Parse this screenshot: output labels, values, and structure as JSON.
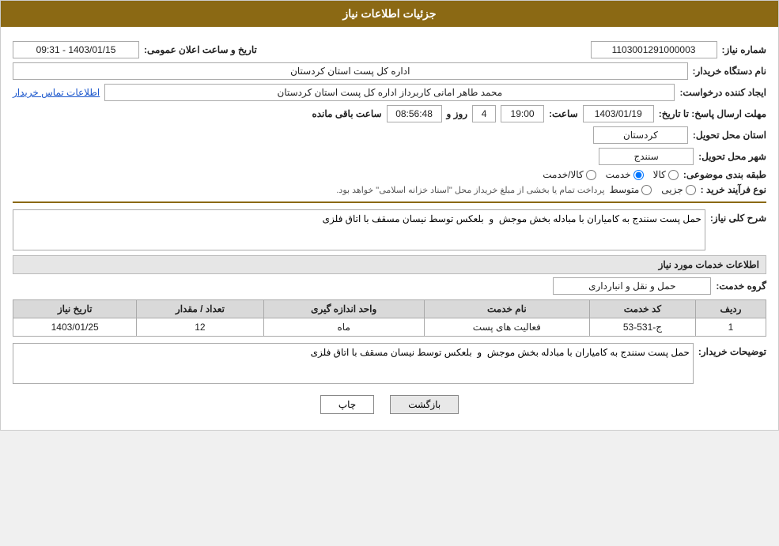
{
  "page": {
    "title": "جزئیات اطلاعات نیاز",
    "header_bg": "#8B6914"
  },
  "fields": {
    "shomara_niaz_label": "شماره نیاز:",
    "shomara_niaz_value": "1103001291000003",
    "nam_dastgah_label": "نام دستگاه خریدار:",
    "nam_dastgah_value": "اداره کل پست استان کردستان",
    "tarikh_label": "تاریخ و ساعت اعلان عمومی:",
    "tarikh_value": "1403/01/15 - 09:31",
    "ijad_konande_label": "ایجاد کننده درخواست:",
    "ijad_konande_value": "محمد طاهر امانی کاربرداز اداره کل پست استان کردستان",
    "ittila_tamas": "اطلاعات تماس خریدار",
    "mohlat_label": "مهلت ارسال پاسخ: تا تاریخ:",
    "mohlat_date": "1403/01/19",
    "mohlat_saat_label": "ساعت:",
    "mohlat_saat": "19:00",
    "mohlat_rooz_label": "روز و",
    "mohlat_rooz_value": "4",
    "mohlat_baqi_label": "ساعت باقی مانده",
    "mohlat_baqi_value": "08:56:48",
    "ostan_tahvil_label": "استان محل تحویل:",
    "ostan_tahvil_value": "کردستان",
    "shahr_tahvil_label": "شهر محل تحویل:",
    "shahr_tahvil_value": "سنندج",
    "tabaqe_label": "طبقه بندی موضوعی:",
    "tabaqe_options": [
      "کالا",
      "خدمت",
      "کالا/خدمت"
    ],
    "tabaqe_selected": "خدمت",
    "noe_farayand_label": "نوع فرآیند خرید :",
    "noe_farayand_options": [
      "جزیی",
      "متوسط"
    ],
    "noe_farayand_note": "پرداخت تمام یا بخشی از مبلغ خریداز محل \"اسناد خزانه اسلامی\" خواهد بود.",
    "sharh_label": "شرح کلی نیاز:",
    "sharh_value": "حمل پست سنندج به کامیاران با مبادله بخش موجش  و  بلعکس توسط نیسان مسقف با اتاق فلزی",
    "khadamat_section": "اطلاعات خدمات مورد نیاز",
    "goroh_label": "گروه خدمت:",
    "goroh_value": "حمل و نقل و انبارداری",
    "table": {
      "headers": [
        "ردیف",
        "کد خدمت",
        "نام خدمت",
        "واحد اندازه گیری",
        "تعداد / مقدار",
        "تاریخ نیاز"
      ],
      "rows": [
        {
          "radif": "1",
          "kod": "ج-531-53",
          "nam": "فعالیت های پست",
          "vahed": "ماه",
          "tedad": "12",
          "tarikh": "1403/01/25"
        }
      ]
    },
    "toseeh_label": "توضیحات خریدار:",
    "toseeh_value": "حمل پست سنندج به کامیاران با مبادله بخش موجش  و  بلعکس توسط نیسان مسقف با اتاق فلزی",
    "btn_print": "چاپ",
    "btn_back": "بازگشت"
  }
}
